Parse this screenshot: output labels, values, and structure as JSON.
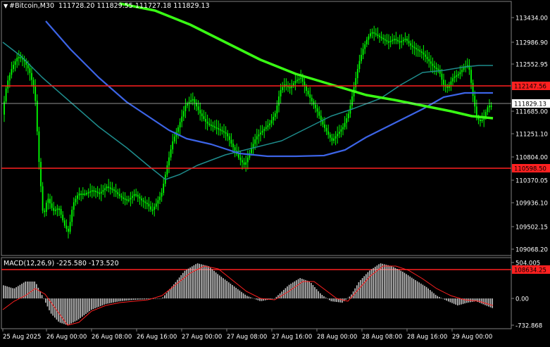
{
  "header": {
    "symbol": "#Bitcoin,M30",
    "ohlc": "111728.20 111829.55 111727.18 111829.13"
  },
  "macd": {
    "label": "MACD(12,26,9)",
    "values": "-225.580 -173.520",
    "axis": [
      "504.005",
      "0.00",
      "-732.868"
    ]
  },
  "price_axis": {
    "ticks": [
      "113434.00",
      "112986.90",
      "112552.95",
      "111685.00",
      "111251.10",
      "110804.00",
      "110370.05",
      "109936.10",
      "109502.15",
      "109068.20",
      "108634.25"
    ],
    "current_price": "111829.13",
    "levels": [
      {
        "value": "112147.56",
        "color": "#ff2020"
      },
      {
        "value": "110598.50",
        "color": "#ff2020"
      },
      {
        "value": "108634.25",
        "color": "#ff2020"
      }
    ]
  },
  "time_axis": [
    "25 Aug 2025",
    "26 Aug 00:00",
    "26 Aug 08:00",
    "26 Aug 16:00",
    "27 Aug 00:00",
    "27 Aug 08:00",
    "27 Aug 16:00",
    "28 Aug 00:00",
    "28 Aug 08:00",
    "28 Aug 16:00",
    "29 Aug 00:00"
  ],
  "colors": {
    "candles": "#00ff00",
    "ma_fast": "#1e8c8c",
    "ma_mid": "#3c64e6",
    "ma_slow": "#39ff14",
    "macd_hist": "#c0c0c0",
    "macd_signal": "#ff2020"
  }
}
